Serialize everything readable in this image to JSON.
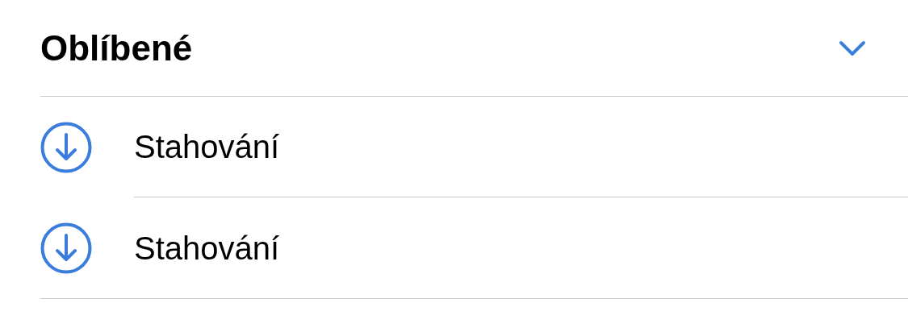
{
  "section": {
    "title": "Oblíbené",
    "expanded": true,
    "items": [
      {
        "label": "Stahování"
      },
      {
        "label": "Stahování"
      }
    ]
  }
}
